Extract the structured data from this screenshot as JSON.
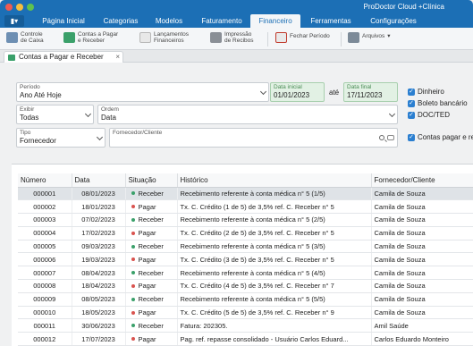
{
  "window": {
    "title": "ProDoctor Cloud +Clínica"
  },
  "menu": {
    "items": [
      "Página Inicial",
      "Categorias",
      "Modelos",
      "Faturamento",
      "Financeiro",
      "Ferramentas",
      "Configurações"
    ],
    "active": "Financeiro"
  },
  "ribbon": {
    "controle_caixa": "Controle\nde Caixa",
    "contas": "Contas a Pagar\ne Receber",
    "lancamentos": "Lançamentos\nFinanceiros",
    "impressao": "Impressão\nde Recibos",
    "fechar_periodo": "Fechar Período",
    "arquivos": "Arquivos"
  },
  "tab": {
    "label": "Contas a Pagar e Receber",
    "close": "×"
  },
  "filters": {
    "periodo_caption": "Período",
    "periodo_value": "Ano Até Hoje",
    "data_inicial_caption": "Data inicial",
    "data_inicial_value": "01/01/2023",
    "ate_label": "até",
    "data_final_caption": "Data final",
    "data_final_value": "17/11/2023",
    "exibir_caption": "Exibir",
    "exibir_value": "Todas",
    "ordem_caption": "Ordem",
    "ordem_value": "Data",
    "tipo_caption": "Tipo",
    "tipo_value": "Fornecedor",
    "fornecedor_caption": "Fornecedor/Cliente",
    "fornecedor_value": "",
    "checks": [
      "Dinheiro",
      "Boleto bancário",
      "DOC/TED",
      "Contas pagar e rec"
    ]
  },
  "grid": {
    "headers": [
      "Número",
      "Data",
      "Situação",
      "Histórico",
      "Fornecedor/Cliente"
    ],
    "colors": {
      "receber": "#3aa06a",
      "pagar": "#d9534f"
    },
    "rows": [
      {
        "num": "000001",
        "date": "08/01/2023",
        "status": "Receber",
        "hist": "Recebimento referente à conta médica n° 5 (1/5)",
        "forn": "Camila de Souza"
      },
      {
        "num": "000002",
        "date": "18/01/2023",
        "status": "Pagar",
        "hist": "Tx. C. Crédito (1 de 5) de 3,5% ref. C. Receber n° 5",
        "forn": "Camila de Souza"
      },
      {
        "num": "000003",
        "date": "07/02/2023",
        "status": "Receber",
        "hist": "Recebimento referente à conta médica n° 5 (2/5)",
        "forn": "Camila de Souza"
      },
      {
        "num": "000004",
        "date": "17/02/2023",
        "status": "Pagar",
        "hist": "Tx. C. Crédito (2 de 5) de 3,5% ref. C. Receber n° 5",
        "forn": "Camila de Souza"
      },
      {
        "num": "000005",
        "date": "09/03/2023",
        "status": "Receber",
        "hist": "Recebimento referente à conta médica n° 5 (3/5)",
        "forn": "Camila de Souza"
      },
      {
        "num": "000006",
        "date": "19/03/2023",
        "status": "Pagar",
        "hist": "Tx. C. Crédito (3 de 5) de 3,5% ref. C. Receber n° 5",
        "forn": "Camila de Souza"
      },
      {
        "num": "000007",
        "date": "08/04/2023",
        "status": "Receber",
        "hist": "Recebimento referente à conta médica n° 5 (4/5)",
        "forn": "Camila de Souza"
      },
      {
        "num": "000008",
        "date": "18/04/2023",
        "status": "Pagar",
        "hist": "Tx. C. Crédito (4 de 5) de 3,5% ref. C. Receber n° 7",
        "forn": "Camila de Souza"
      },
      {
        "num": "000009",
        "date": "08/05/2023",
        "status": "Receber",
        "hist": "Recebimento referente à conta médica n° 5 (5/5)",
        "forn": "Camila de Souza"
      },
      {
        "num": "000010",
        "date": "18/05/2023",
        "status": "Pagar",
        "hist": "Tx. C. Crédito (5 de 5) de 3,5% ref. C. Receber n° 9",
        "forn": "Camila de Souza"
      },
      {
        "num": "000011",
        "date": "30/06/2023",
        "status": "Receber",
        "hist": "Fatura: 202305.",
        "forn": "Amil Saúde"
      },
      {
        "num": "000012",
        "date": "17/07/2023",
        "status": "Pagar",
        "hist": "Pag. ref. repasse consolidado - Usuário Carlos Eduard...",
        "forn": "Carlos Eduardo Monteiro"
      }
    ]
  }
}
